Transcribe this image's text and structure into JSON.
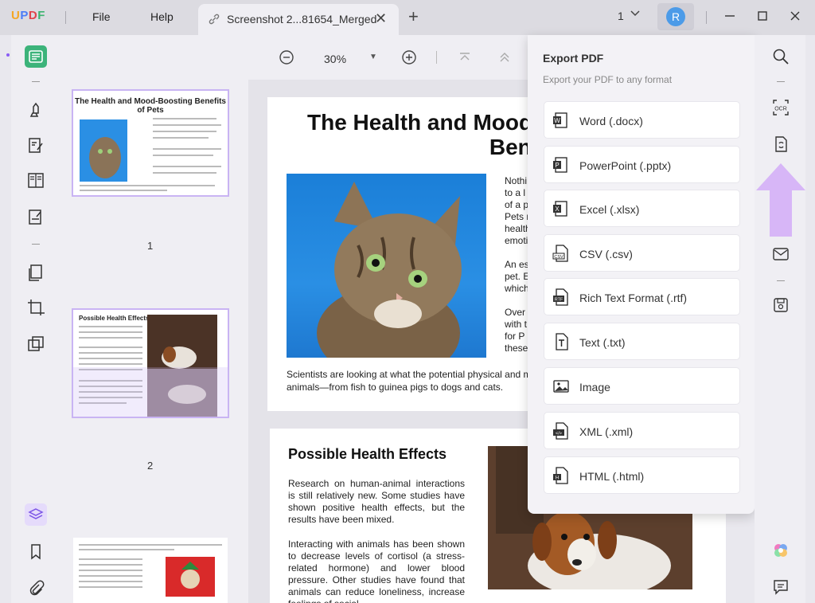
{
  "app": {
    "logo": "UPDF"
  },
  "menu": {
    "file": "File",
    "help": "Help"
  },
  "tab": {
    "title": "Screenshot 2...81654_Merged"
  },
  "pagination": {
    "current": "1"
  },
  "user": {
    "initial": "R"
  },
  "toolbar": {
    "zoom": "30%"
  },
  "export": {
    "title": "Export PDF",
    "subtitle": "Export your PDF to any format",
    "items": [
      {
        "label": "Word (.docx)",
        "icon": "word-icon",
        "color": "#1f1f1f"
      },
      {
        "label": "PowerPoint (.pptx)",
        "icon": "powerpoint-icon",
        "color": "#1f1f1f"
      },
      {
        "label": "Excel (.xlsx)",
        "icon": "excel-icon",
        "color": "#1f1f1f"
      },
      {
        "label": "CSV (.csv)",
        "icon": "csv-icon",
        "color": "#1f1f1f"
      },
      {
        "label": "Rich Text Format (.rtf)",
        "icon": "rtf-icon",
        "color": "#1f1f1f"
      },
      {
        "label": "Text (.txt)",
        "icon": "text-icon",
        "color": "#1f1f1f"
      },
      {
        "label": "Image",
        "icon": "image-icon",
        "color": "#1f1f1f"
      },
      {
        "label": "XML (.xml)",
        "icon": "xml-icon",
        "color": "#1f1f1f"
      },
      {
        "label": "HTML (.html)",
        "icon": "html-icon",
        "color": "#1f1f1f"
      }
    ]
  },
  "thumbnails": [
    {
      "number": "1",
      "title": "The Health and Mood-Boosting Benefits of Pets"
    },
    {
      "number": "2",
      "title": "Possible Health Effects"
    }
  ],
  "page1": {
    "title_line1": "The Health and Mood",
    "title_line2": "Benefits of P",
    "side_lines_a": [
      "Nothi",
      "to a l",
      "of a p",
      "Pets r",
      "health",
      "emoti"
    ],
    "side_lines_b": [
      "An es",
      "pet. E",
      "which"
    ],
    "side_lines_c": [
      "Over",
      "with t",
      "for P",
      "these"
    ],
    "caption": "Scientists are looking at what the potential physical and m animals—from fish to guinea pigs to dogs and cats."
  },
  "page2": {
    "heading": "Possible Health Effects",
    "para1": "Research on human-animal interactions is still relatively new. Some studies have shown positive health effects, but the results have been mixed.",
    "para2": "Interacting with animals has been shown to decrease levels of cortisol (a stress-related hormone) and lower blood pressure. Other studies have found that animals can reduce loneliness, increase feelings of social"
  },
  "colors": {
    "accent": "#8a5cf5",
    "active_tool": "#3cb37a",
    "arrow": "#d7b6f7"
  }
}
